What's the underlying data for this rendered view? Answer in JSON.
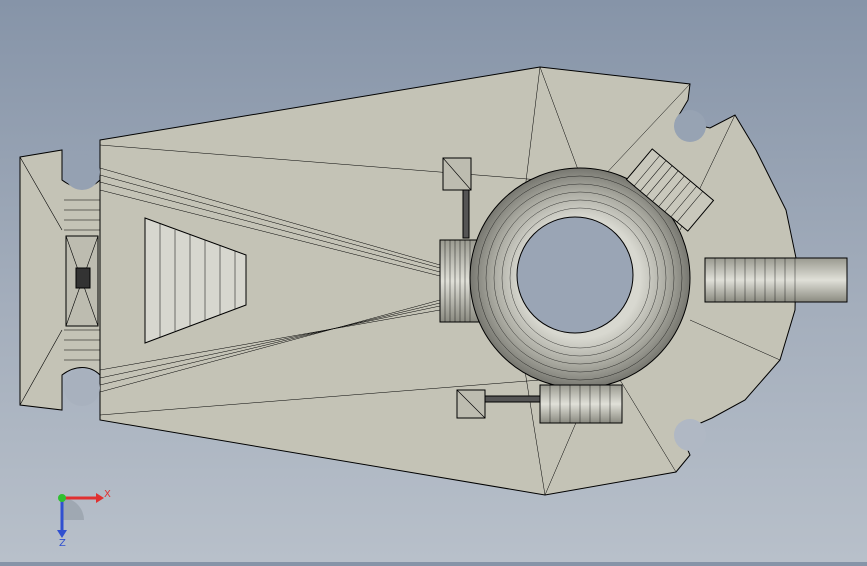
{
  "viewport": {
    "background_top": "#8694a8",
    "background_bottom": "#b8c0ca",
    "part_fill": "#c4c3b6",
    "edge_color": "#000000"
  },
  "triad": {
    "x_label": "X",
    "z_label": "Z",
    "x_color": "#e03030",
    "y_color": "#30c030",
    "z_color": "#3050d0"
  }
}
